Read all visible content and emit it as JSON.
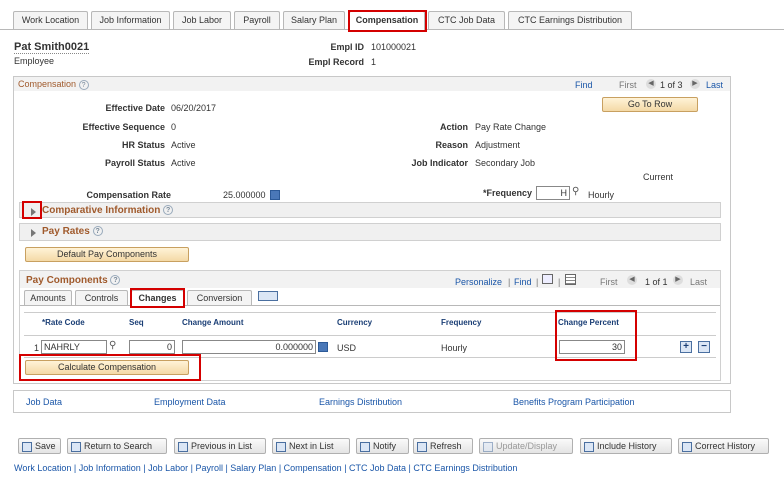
{
  "tabs": [
    "Work Location",
    "Job Information",
    "Job Labor",
    "Payroll",
    "Salary Plan",
    "Compensation",
    "CTC Job Data",
    "CTC Earnings Distribution"
  ],
  "employee": {
    "name": "Pat Smith0021",
    "role": "Employee",
    "empl_id_label": "Empl ID",
    "empl_id": "101000021",
    "empl_record_label": "Empl Record",
    "empl_record": "1"
  },
  "compensation": {
    "title": "Compensation",
    "find": "Find",
    "first": "First",
    "counter": "1 of 3",
    "last": "Last",
    "goto_row": "Go To Row",
    "effective_date_label": "Effective Date",
    "effective_date": "06/20/2017",
    "effective_seq_label": "Effective Sequence",
    "effective_seq": "0",
    "hr_status_label": "HR Status",
    "hr_status": "Active",
    "payroll_status_label": "Payroll Status",
    "payroll_status": "Active",
    "action_label": "Action",
    "action": "Pay Rate Change",
    "reason_label": "Reason",
    "reason": "Adjustment",
    "job_indicator_label": "Job Indicator",
    "job_indicator": "Secondary Job",
    "current": "Current",
    "comp_rate_label": "Compensation Rate",
    "comp_rate": "25.000000",
    "frequency_label": "*Frequency",
    "frequency_code": "H",
    "frequency_desc": "Hourly"
  },
  "comparative": "Comparative Information",
  "pay_rates": "Pay Rates",
  "default_btn": "Default Pay Components",
  "pay_components": {
    "title": "Pay Components",
    "personalize": "Personalize",
    "find": "Find",
    "first": "First",
    "counter": "1 of 1",
    "last": "Last",
    "subtabs": [
      "Amounts",
      "Controls",
      "Changes",
      "Conversion"
    ],
    "columns": [
      "*Rate Code",
      "Seq",
      "Change Amount",
      "Currency",
      "Frequency",
      "Change Percent"
    ],
    "row": {
      "num": "1",
      "rate_code": "NAHRLY",
      "seq": "0",
      "change_amount": "0.000000",
      "currency": "USD",
      "frequency": "Hourly",
      "change_percent": "30"
    },
    "calc_btn": "Calculate Compensation"
  },
  "links": [
    "Job Data",
    "Employment Data",
    "Earnings Distribution",
    "Benefits Program Participation"
  ],
  "toolbar": [
    "Save",
    "Return to Search",
    "Previous in List",
    "Next in List",
    "Notify",
    "Refresh",
    "Update/Display",
    "Include History",
    "Correct History"
  ],
  "footer": "Work Location | Job Information | Job Labor | Payroll | Salary Plan | Compensation | CTC Job Data | CTC Earnings Distribution"
}
